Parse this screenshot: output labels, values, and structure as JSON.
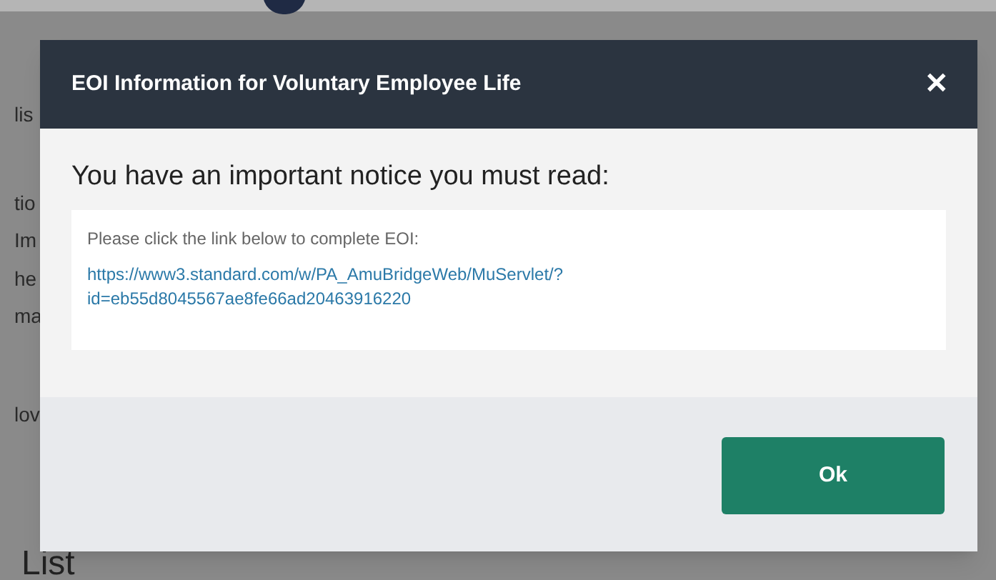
{
  "background_page": {
    "fragments": [
      "lis",
      "tio",
      "Im",
      "he",
      "ma",
      "lov"
    ],
    "heading": "List"
  },
  "dialog": {
    "title": "EOI Information for Voluntary Employee Life",
    "close": "✕",
    "heading": "You have an important notice you must read:",
    "notice": {
      "text": "Please click the link below to complete EOI:",
      "link": "https://www3.standard.com/w/PA_AmuBridgeWeb/MuServlet/?id=eb55d8045567ae8fe66ad20463916220"
    },
    "buttons": [
      "Ok"
    ]
  }
}
